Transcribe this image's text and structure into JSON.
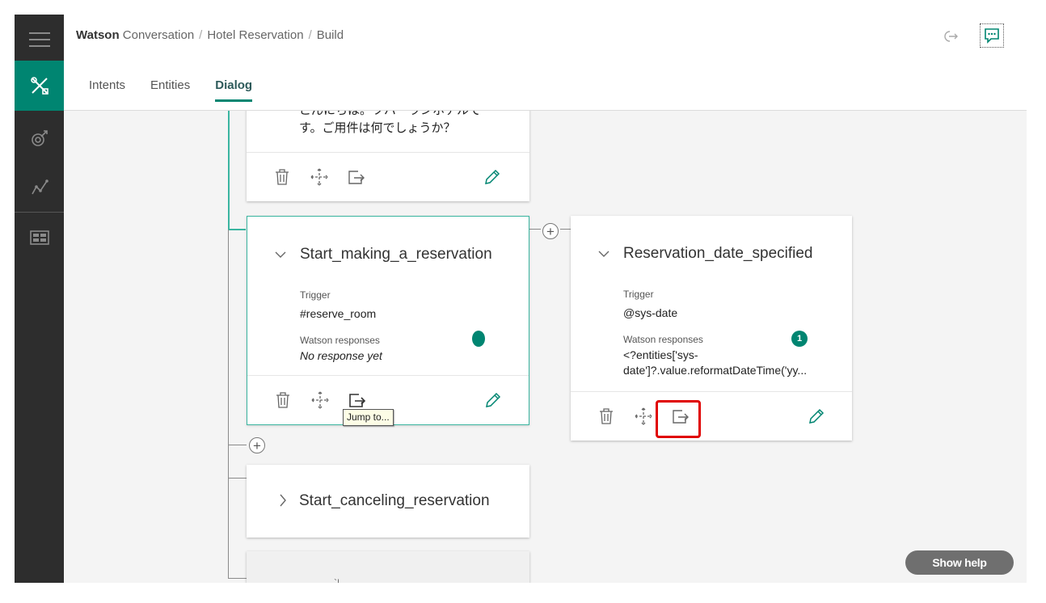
{
  "breadcrumb": {
    "brand": "Watson",
    "product": "Conversation",
    "workspace": "Hotel Reservation",
    "section": "Build"
  },
  "tabs": [
    {
      "label": "Intents",
      "active": false
    },
    {
      "label": "Entities",
      "active": false
    },
    {
      "label": "Dialog",
      "active": true
    }
  ],
  "rail": {
    "items": [
      "menu-icon",
      "tools-icon",
      "deploy-icon",
      "analytics-icon",
      "workspaces-icon"
    ],
    "active_color": "#008571"
  },
  "nodes": {
    "top": {
      "response_line1": "こんにちは。ツバーランホテルで",
      "response_line2": "す。ご用件は何でしょうか？"
    },
    "start_reservation": {
      "title": "Start_making_a_reservation",
      "trigger_label": "Trigger",
      "trigger": "#reserve_room",
      "responses_label": "Watson responses",
      "response": "No response yet"
    },
    "date_specified": {
      "title": "Reservation_date_specified",
      "trigger_label": "Trigger",
      "trigger": "@sys-date",
      "responses_label": "Watson responses",
      "response_count": "1",
      "response_line1": "<?entities['sys-",
      "response_line2": "date']?.value.reformatDateTime('yy..."
    },
    "cancel_reservation": {
      "title": "Start_canceling_reservation"
    },
    "bottom_partial": {
      "text": "`|"
    }
  },
  "tooltip": "Jump to...",
  "show_help": "Show help",
  "colors": {
    "accent": "#008571",
    "connector_selected": "#3ab5a0",
    "highlight": "#e00000"
  }
}
